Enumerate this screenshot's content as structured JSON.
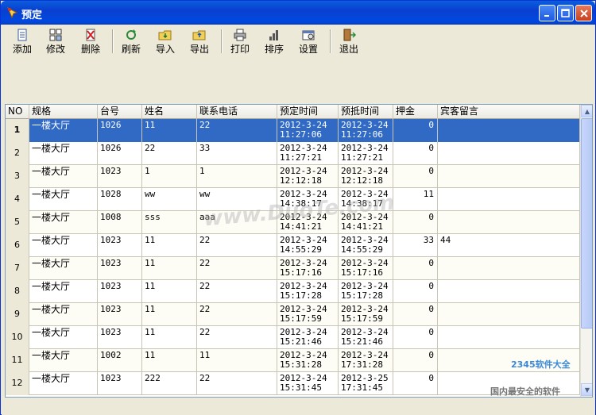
{
  "window": {
    "title": "预定"
  },
  "toolbar": {
    "items": [
      {
        "label": "添加",
        "icon": "add-doc-icon"
      },
      {
        "label": "修改",
        "icon": "edit-grid-icon"
      },
      {
        "label": "删除",
        "icon": "delete-icon"
      },
      {
        "label": "刷新",
        "icon": "refresh-icon"
      },
      {
        "label": "导入",
        "icon": "import-folder-icon"
      },
      {
        "label": "导出",
        "icon": "export-folder-icon"
      },
      {
        "label": "打印",
        "icon": "printer-icon"
      },
      {
        "label": "排序",
        "icon": "sort-bars-icon"
      },
      {
        "label": "设置",
        "icon": "settings-icon"
      },
      {
        "label": "退出",
        "icon": "exit-door-icon"
      }
    ]
  },
  "table": {
    "columns": [
      "NO",
      "规格",
      "台号",
      "姓名",
      "联系电话",
      "预定时间",
      "预抵时间",
      "押金",
      "宾客留言"
    ],
    "rows": [
      {
        "no": "1",
        "spec": "一楼大厅",
        "table": "1026",
        "name": "11",
        "phone": "22",
        "booked": "2012-3-24\n11:27:06",
        "arrive": "2012-3-24\n11:27:06",
        "deposit": "0",
        "msg": ""
      },
      {
        "no": "2",
        "spec": "一楼大厅",
        "table": "1026",
        "name": "22",
        "phone": "33",
        "booked": "2012-3-24\n11:27:21",
        "arrive": "2012-3-24\n11:27:21",
        "deposit": "0",
        "msg": ""
      },
      {
        "no": "3",
        "spec": "一楼大厅",
        "table": "1023",
        "name": "1",
        "phone": "1",
        "booked": "2012-3-24\n12:12:18",
        "arrive": "2012-3-24\n12:12:18",
        "deposit": "0",
        "msg": ""
      },
      {
        "no": "4",
        "spec": "一楼大厅",
        "table": "1028",
        "name": "ww",
        "phone": "ww",
        "booked": "2012-3-24\n14:38:17",
        "arrive": "2012-3-24\n14:38:17",
        "deposit": "11",
        "msg": ""
      },
      {
        "no": "5",
        "spec": "一楼大厅",
        "table": "1008",
        "name": "sss",
        "phone": "aaa",
        "booked": "2012-3-24\n14:41:21",
        "arrive": "2012-3-24\n14:41:21",
        "deposit": "0",
        "msg": ""
      },
      {
        "no": "6",
        "spec": "一楼大厅",
        "table": "1023",
        "name": "11",
        "phone": "22",
        "booked": "2012-3-24\n14:55:29",
        "arrive": "2012-3-24\n14:55:29",
        "deposit": "33",
        "msg": "44"
      },
      {
        "no": "7",
        "spec": "一楼大厅",
        "table": "1023",
        "name": "11",
        "phone": "22",
        "booked": "2012-3-24\n15:17:16",
        "arrive": "2012-3-24\n15:17:16",
        "deposit": "0",
        "msg": ""
      },
      {
        "no": "8",
        "spec": "一楼大厅",
        "table": "1023",
        "name": "11",
        "phone": "22",
        "booked": "2012-3-24\n15:17:28",
        "arrive": "2012-3-24\n15:17:28",
        "deposit": "0",
        "msg": ""
      },
      {
        "no": "9",
        "spec": "一楼大厅",
        "table": "1023",
        "name": "11",
        "phone": "22",
        "booked": "2012-3-24\n15:17:59",
        "arrive": "2012-3-24\n15:17:59",
        "deposit": "0",
        "msg": ""
      },
      {
        "no": "10",
        "spec": "一楼大厅",
        "table": "1023",
        "name": "11",
        "phone": "22",
        "booked": "2012-3-24\n15:21:46",
        "arrive": "2012-3-24\n15:21:46",
        "deposit": "0",
        "msg": ""
      },
      {
        "no": "11",
        "spec": "一楼大厅",
        "table": "1002",
        "name": "11",
        "phone": "11",
        "booked": "2012-3-24\n15:31:28",
        "arrive": "2012-3-24\n17:31:28",
        "deposit": "0",
        "msg": ""
      },
      {
        "no": "12",
        "spec": "一楼大厅",
        "table": "1023",
        "name": "222",
        "phone": "22",
        "booked": "2012-3-24\n15:31:45",
        "arrive": "2012-3-25\n17:31:45",
        "deposit": "0",
        "msg": ""
      }
    ]
  },
  "watermark": {
    "text": "www.DuoTe.com",
    "brand": "2345软件大全",
    "slogan": "国内最安全的软件"
  },
  "colors": {
    "titlebar": "#0a3fd0",
    "selection": "#316ac5",
    "face": "#ece9d8"
  }
}
